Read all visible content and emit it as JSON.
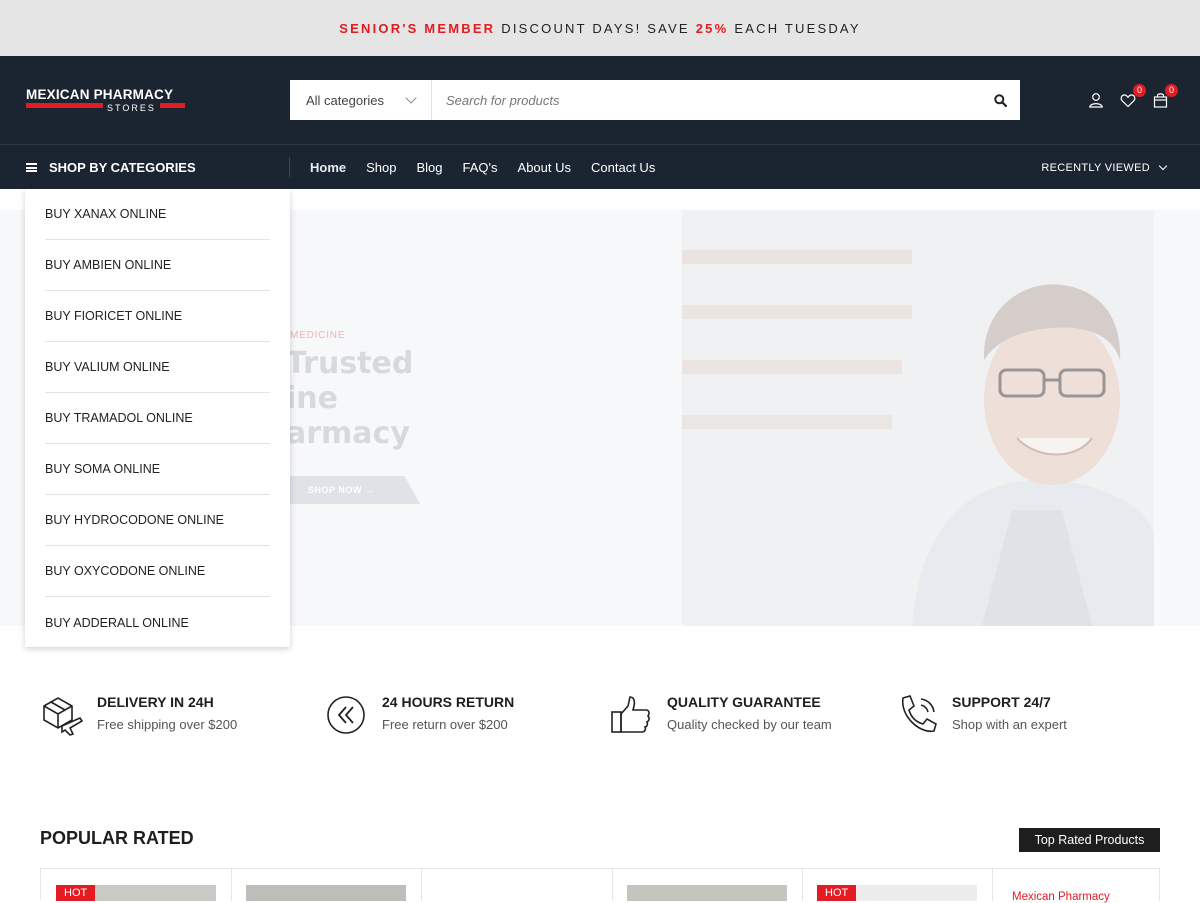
{
  "promo": {
    "part1": "SENIOR'S MEMBER",
    "part2": "DISCOUNT DAYS! SAVE",
    "part3": "25%",
    "part4": "EACH TUESDAY"
  },
  "logo": {
    "line1": "MEXICAN PHARMACY",
    "line2": "STORES"
  },
  "search": {
    "category": "All categories",
    "placeholder": "Search for products"
  },
  "header_icons": {
    "wishlist_count": "0",
    "cart_count": "0"
  },
  "nav": {
    "shop_by_categories": "SHOP BY CATEGORIES",
    "items": [
      {
        "label": "Home"
      },
      {
        "label": "Shop"
      },
      {
        "label": "Blog"
      },
      {
        "label": "FAQ's"
      },
      {
        "label": "About Us"
      },
      {
        "label": "Contact Us"
      }
    ],
    "recently_viewed": "RECENTLY VIEWED"
  },
  "categories": [
    {
      "label": "BUY XANAX ONLINE"
    },
    {
      "label": "BUY AMBIEN ONLINE"
    },
    {
      "label": "BUY FIORICET ONLINE"
    },
    {
      "label": "BUY VALIUM ONLINE"
    },
    {
      "label": "BUY TRAMADOL ONLINE"
    },
    {
      "label": "BUY SOMA ONLINE"
    },
    {
      "label": "BUY HYDROCODONE ONLINE"
    },
    {
      "label": "BUY OXYCODONE ONLINE"
    },
    {
      "label": "BUY ADDERALL ONLINE"
    }
  ],
  "hero": {
    "subtitle": "MEDICINE",
    "title_lines": [
      "Trusted",
      "ine",
      "armacy"
    ],
    "button": "SHOP NOW →"
  },
  "features": [
    {
      "icon": "delivery-box-plane-icon",
      "title": "DELIVERY IN 24H",
      "desc": "Free shipping over $200"
    },
    {
      "icon": "return-arrows-icon",
      "title": "24 HOURS RETURN",
      "desc": "Free return over $200"
    },
    {
      "icon": "thumbs-up-icon",
      "title": "QUALITY GUARANTEE",
      "desc": "Quality checked by our team"
    },
    {
      "icon": "phone-icon",
      "title": "SUPPORT 24/7",
      "desc": "Shop with an expert"
    }
  ],
  "popular": {
    "title": "POPULAR RATED",
    "badge": "Top Rated Products",
    "products": [
      {
        "hot": "HOT"
      },
      {
        "hot": ""
      },
      {
        "hot": ""
      },
      {
        "hot": ""
      },
      {
        "hot": "HOT"
      },
      {
        "hot": "",
        "text": "Mexican Pharmacy"
      }
    ]
  },
  "colors": {
    "accent": "#e31c23",
    "header_bg": "#1b2531",
    "promo_bg": "#e5e5e5"
  }
}
